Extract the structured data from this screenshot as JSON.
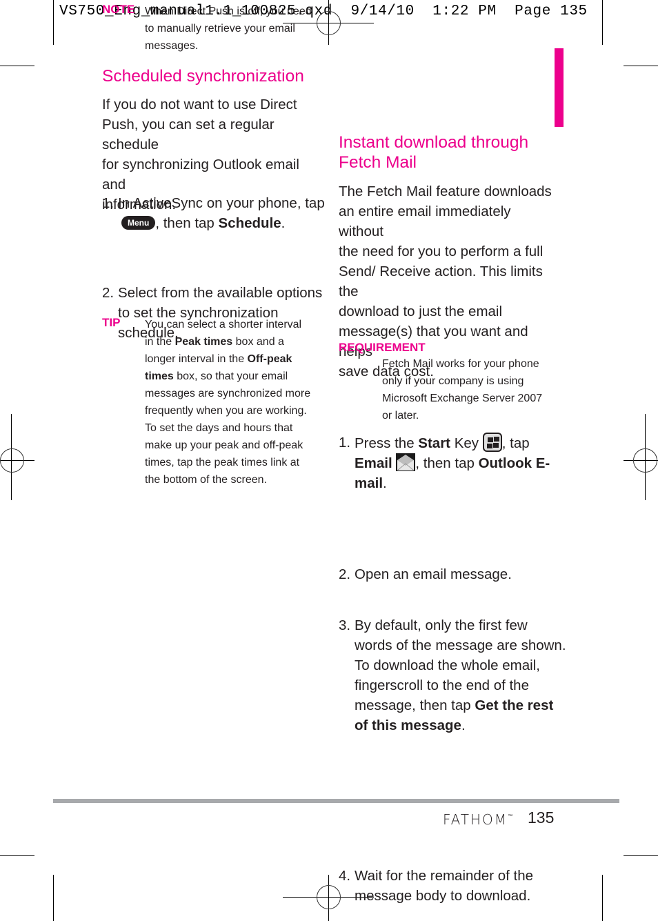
{
  "slug": {
    "file": "VS750_Eng_manual1.1_100825.qxd",
    "date": "9/14/10",
    "time": "1:22 PM",
    "page": "Page 135"
  },
  "accent_color": "#ec008c",
  "left": {
    "note": {
      "label": "NOTE",
      "lines": [
        "When Direct Push is off, you need",
        "to manually retrieve your email",
        "messages."
      ]
    },
    "heading": "Scheduled synchronization",
    "intro": [
      "If you do not want to use Direct",
      "Push, you can set a regular schedule",
      "for synchronizing Outlook email and",
      "information."
    ],
    "steps": [
      {
        "num": "1.",
        "line1": "In ActiveSync on your phone, tap",
        "menu_button": "Menu",
        "then": ", then tap ",
        "bold": "Schedule",
        "end": "."
      },
      {
        "num": "2.",
        "lines": [
          "Select from the available options",
          "to set the synchronization",
          "schedule."
        ]
      }
    ],
    "tip": {
      "label": "TIP",
      "l1": "You can select a shorter interval",
      "l2_pre": "in the ",
      "l2_bold": "Peak times",
      "l2_post": " box and a",
      "l3_pre": "longer interval in the ",
      "l3_bold": "Off-peak",
      "l4_bold": "times",
      "l4_post": " box, so that your email",
      "l5": "messages are synchronized more",
      "l6": "frequently when you are working.",
      "l7": "To set the days and hours that",
      "l8": "make up your peak and off-peak",
      "l9": "times, tap the peak times link at",
      "l10": "the bottom of the screen."
    }
  },
  "right": {
    "heading": [
      "Instant download through",
      "Fetch Mail"
    ],
    "intro": [
      "The Fetch Mail feature downloads",
      "an entire email immediately without",
      "the need for you to perform a full",
      "Send/ Receive action. This limits the",
      "download to just the email",
      "message(s) that you want and helps",
      "save data cost."
    ],
    "requirement": {
      "label": "REQUIREMENT",
      "lines": [
        "Fetch Mail works for your phone",
        "only if your company is using",
        "Microsoft Exchange Server 2007",
        "or later."
      ]
    },
    "steps": [
      {
        "num": "1.",
        "pre": "Press the ",
        "bold1": "Start",
        "mid1": " Key ",
        "icon1": "windows-start-key-icon",
        "mid2": ", tap",
        "bold2": "Email",
        "icon2": "email-envelope-icon",
        "mid3": ", then tap ",
        "bold3": "Outlook E-",
        "bold4": "mail",
        "end": "."
      },
      {
        "num": "2.",
        "lines": [
          "Open an email message."
        ]
      },
      {
        "num": "3.",
        "lines": [
          "By default, only the first few",
          "words of the message are shown.",
          "To download the whole email,",
          "fingerscroll to the end of the"
        ],
        "l5_pre": "message, then tap ",
        "l5_bold": "Get the rest",
        "l6_bold": "of this message",
        "end": "."
      },
      {
        "num": "4.",
        "lines": [
          "Wait for the remainder of the",
          "message body to download."
        ]
      }
    ]
  },
  "footer": {
    "brand": "FATHOM",
    "tm": "™",
    "page_number": "135"
  }
}
